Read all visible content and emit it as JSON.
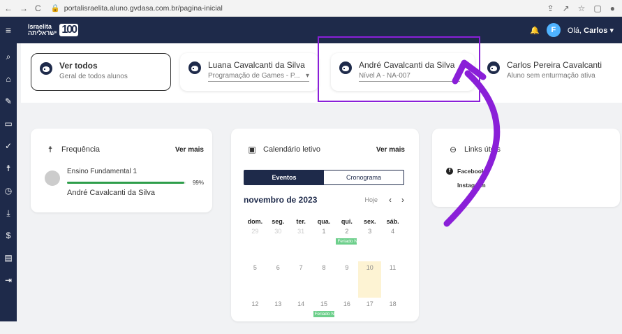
{
  "browser": {
    "url": "portalisraelita.aluno.gvdasa.com.br/pagina-inicial"
  },
  "topbar": {
    "logo_text_1": "Israelita",
    "logo_text_2": "ישראליתה",
    "logo_number": "100",
    "greeting_prefix": "Olá,",
    "user_name": "Carlos",
    "avatar_initial": "F"
  },
  "students": [
    {
      "name": "Ver todos",
      "sub": "Geral de todos alunos"
    },
    {
      "name": "Luana Cavalcanti da Silva",
      "sub": "Programação de Games - P..."
    },
    {
      "name": "André Cavalcanti da Silva",
      "sub": "Nível A - NA-007"
    },
    {
      "name": "Carlos Pereira Cavalcanti",
      "sub": "Aluno sem enturmação ativa"
    }
  ],
  "frequencia": {
    "title": "Frequência",
    "ver_mais": "Ver mais",
    "course": "Ensino Fundamental 1",
    "percent_label": "99%",
    "percent": 99,
    "student": "André Cavalcanti da Silva"
  },
  "calendario": {
    "title": "Calendário letivo",
    "ver_mais": "Ver mais",
    "tab_eventos": "Eventos",
    "tab_cronograma": "Cronograma",
    "month": "novembro de 2023",
    "hoje": "Hoje",
    "weekdays": [
      "dom.",
      "seg.",
      "ter.",
      "qua.",
      "qui.",
      "sex.",
      "sáb."
    ],
    "week1": [
      "29",
      "30",
      "31",
      "1",
      "2",
      "3",
      "4"
    ],
    "week2": [
      "5",
      "6",
      "7",
      "8",
      "9",
      "10",
      "11"
    ],
    "week3": [
      "12",
      "13",
      "14",
      "15",
      "16",
      "17",
      "18"
    ],
    "event_label": "Feriado N"
  },
  "links": {
    "title": "Links úteis",
    "facebook": "Facebook",
    "instagram": "Instagram"
  },
  "colors": {
    "navy": "#1e2a4a",
    "highlight": "#8a1fd8",
    "progress": "#2e9e4b"
  }
}
